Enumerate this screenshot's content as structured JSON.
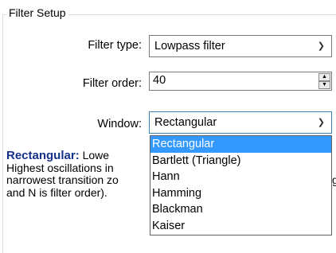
{
  "group": {
    "title": "Filter Setup"
  },
  "filter_type": {
    "label": "Filter type:",
    "value": "Lowpass filter"
  },
  "filter_order": {
    "label": "Filter order:",
    "value": "40"
  },
  "window": {
    "label": "Window:",
    "value": "Rectangular",
    "options": [
      "Rectangular",
      "Bartlett (Triangle)",
      "Hann",
      "Hamming",
      "Blackman",
      "Kaiser"
    ]
  },
  "description": {
    "title": "Rectangular:",
    "line1_rest": " Lowe",
    "line2": "Highest oscillations in",
    "line3": "narrowest transition zo",
    "line4": "and N is filter order).",
    "cut_char": "g"
  },
  "icons": {
    "combo_arrow": "chevron-down-icon",
    "spin_up": "triangle-up-icon",
    "spin_down": "triangle-down-icon"
  }
}
